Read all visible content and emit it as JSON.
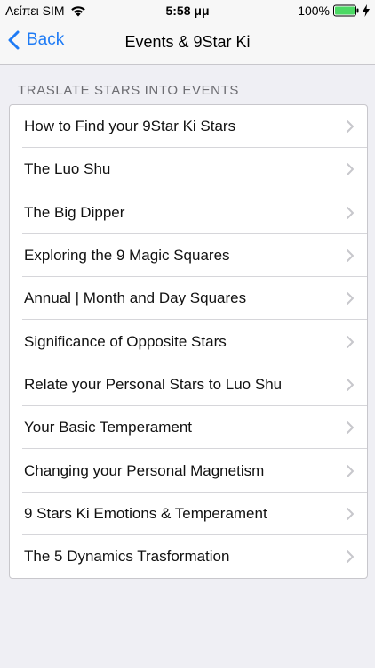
{
  "status_bar": {
    "carrier": "Λείπει SIM",
    "time": "5:58 μμ",
    "battery": "100%"
  },
  "nav": {
    "back_label": "Back",
    "title": "Events & 9Star Ki"
  },
  "section": {
    "header": "TRASLATE STARS INTO EVENTS"
  },
  "list": {
    "items": [
      {
        "label": "How to Find your 9Star Ki Stars"
      },
      {
        "label": "The Luo Shu"
      },
      {
        "label": "The Big Dipper"
      },
      {
        "label": "Exploring the 9 Magic Squares"
      },
      {
        "label": "Annual | Month and Day Squares"
      },
      {
        "label": "Significance of Opposite Stars"
      },
      {
        "label": "Relate your Personal Stars to Luo Shu"
      },
      {
        "label": "Your Basic Temperament"
      },
      {
        "label": "Changing your Personal Magnetism"
      },
      {
        "label": "9 Stars Ki Emotions & Temperament"
      },
      {
        "label": "The 5 Dynamics Trasformation"
      }
    ]
  },
  "colors": {
    "accent": "#1e7bf5",
    "battery": "#4cd964",
    "background": "#efeff4"
  }
}
